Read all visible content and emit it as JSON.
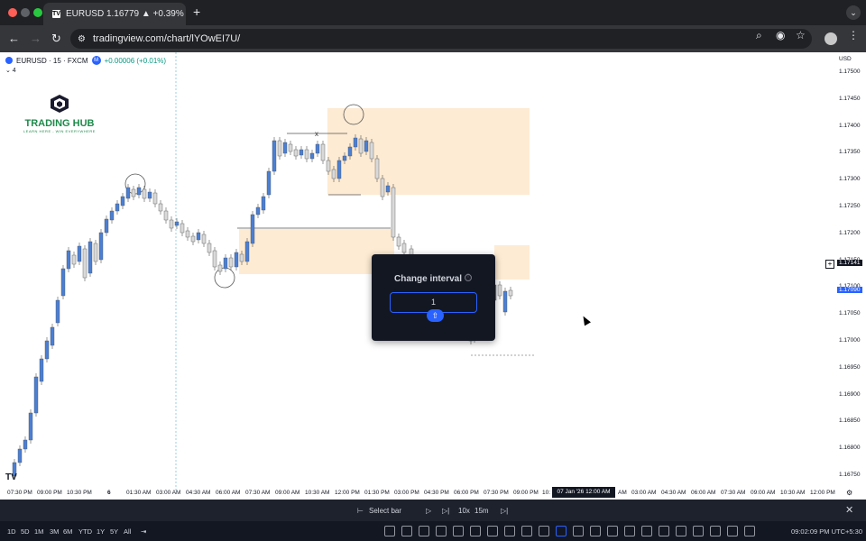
{
  "browser": {
    "tab_title": "EURUSD 1.16779 ▲ +0.39% ⋅ T",
    "favicon": "TV",
    "new_tab": "+",
    "tab_menu": "⌄",
    "url": "tradingview.com/chart/lYOwEI7U/"
  },
  "chart": {
    "symbol": "EURUSD · 15 · FXCM",
    "badge": "M",
    "change": "+0.00006 (+0.01%)",
    "indicator_count": "⌄ 4",
    "currency": "USD",
    "logo_brand": "TRADING HUB",
    "logo_tagline": "LEARN HERE - WIN EVERYWHERE",
    "current_price": "1.17141",
    "last_price": "1.17090",
    "crosshair_time": "07 Jan '26   12:00 AM",
    "x_marker": "x",
    "price_labels": [
      "1.17500",
      "1.17450",
      "1.17400",
      "1.17350",
      "1.17300",
      "1.17250",
      "1.17200",
      "1.17150",
      "1.17100",
      "1.17050",
      "1.17000",
      "1.16950",
      "1.16900",
      "1.16850",
      "1.16800",
      "1.16750"
    ],
    "time_labels": [
      "07:30 PM",
      "09:00 PM",
      "10:30 PM",
      "6",
      "01:30 AM",
      "03:00 AM",
      "04:30 AM",
      "06:00 AM",
      "07:30 AM",
      "09:00 AM",
      "10:30 AM",
      "12:00 PM",
      "01:30 PM",
      "03:00 PM",
      "04:30 PM",
      "06:00 PM",
      "07:30 PM",
      "09:00 PM",
      "10:",
      "AM",
      "03:00 AM",
      "04:30 AM",
      "06:00 AM",
      "07:30 AM",
      "09:00 AM",
      "10:30 AM",
      "12:00 PM"
    ]
  },
  "modal": {
    "title": "Change interval",
    "info_icon": "ⓘ",
    "input_value": "1",
    "hint_key": "⇧"
  },
  "replay": {
    "select_bar": "Select bar",
    "speed": "10x",
    "interval": "15m",
    "close": "✕"
  },
  "bottom": {
    "ranges": [
      "1D",
      "5D",
      "1M",
      "3M",
      "6M",
      "YTD",
      "1Y",
      "5Y",
      "All"
    ],
    "clock": "09:02:09 PM UTC+5:30"
  },
  "colors": {
    "bull": "#4a7fd4",
    "bear": "#d9d9d9",
    "zone": "#fdebd3",
    "accent": "#2962ff"
  }
}
